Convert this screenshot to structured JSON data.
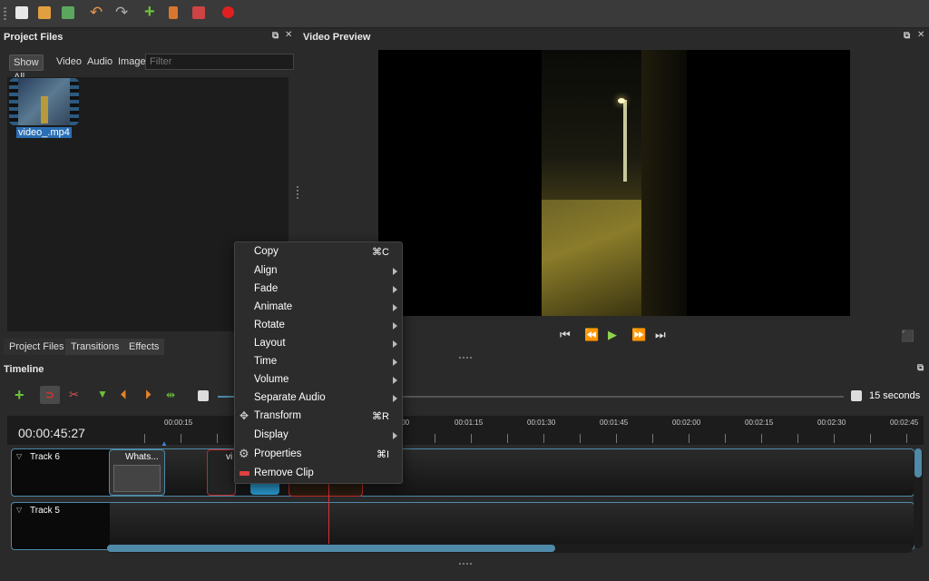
{
  "project_files": {
    "title": "Project Files",
    "filters": [
      "Show All",
      "Video",
      "Audio",
      "Image"
    ],
    "filter_placeholder": "Filter",
    "file_name": "video_.mp4"
  },
  "bottom_tabs": [
    "Project Files",
    "Transitions",
    "Effects"
  ],
  "video_preview": {
    "title": "Video Preview"
  },
  "timeline": {
    "title": "Timeline",
    "timecode": "00:00:45:27",
    "zoom": "15 seconds",
    "ruler": [
      "00:00:15",
      ":00",
      "00:01:15",
      "00:01:30",
      "00:01:45",
      "00:02:00",
      "00:02:15",
      "00:02:30",
      "00:02:45"
    ],
    "tracks": [
      "Track 6",
      "Track 5"
    ],
    "clips": [
      "Whats...",
      "vi"
    ]
  },
  "context_menu": {
    "items": [
      {
        "label": "Copy",
        "shortcut": "⌘C",
        "submenu": false
      },
      {
        "label": "Align",
        "shortcut": "",
        "submenu": true
      },
      {
        "label": "Fade",
        "shortcut": "",
        "submenu": true
      },
      {
        "label": "Animate",
        "shortcut": "",
        "submenu": true
      },
      {
        "label": "Rotate",
        "shortcut": "",
        "submenu": true
      },
      {
        "label": "Layout",
        "shortcut": "",
        "submenu": true
      },
      {
        "label": "Time",
        "shortcut": "",
        "submenu": true
      },
      {
        "label": "Volume",
        "shortcut": "",
        "submenu": true
      },
      {
        "label": "Separate Audio",
        "shortcut": "",
        "submenu": true
      },
      {
        "label": "Transform",
        "shortcut": "⌘R",
        "submenu": false
      },
      {
        "label": "Display",
        "shortcut": "",
        "submenu": true
      },
      {
        "label": "Properties",
        "shortcut": "⌘I",
        "submenu": false
      },
      {
        "label": "Remove Clip",
        "shortcut": "",
        "submenu": false
      }
    ]
  },
  "colors": {
    "accent": "#4f8aa8",
    "playhead": "#e03030",
    "play": "#8fd14f"
  },
  "icons": [
    "new-project-icon",
    "open-project-icon",
    "save-project-icon",
    "undo-icon",
    "redo-icon",
    "import-files-icon",
    "profile-icon",
    "export-icon",
    "record-icon"
  ]
}
